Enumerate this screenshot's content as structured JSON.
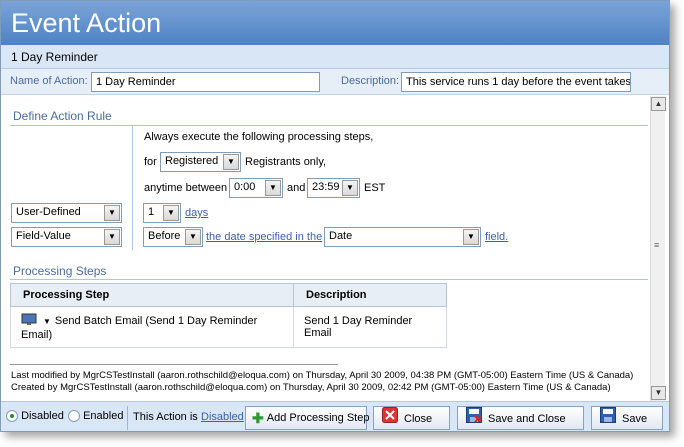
{
  "window": {
    "title": "Event Action",
    "subtitle": "1 Day Reminder"
  },
  "header_fields": {
    "name_label": "Name of Action:",
    "name_value": "1 Day Reminder",
    "description_label": "Description:",
    "description_value": "This service runs 1 day before the event takes"
  },
  "rule": {
    "section_title": "Define Action Rule",
    "always_text": "Always execute the following processing steps,",
    "for_label": "for",
    "registrant_type": "Registered",
    "registrants_only": "Registrants only,",
    "anytime_between": "anytime between",
    "time_start": "0:00",
    "and_label": "and",
    "time_end": "23:59",
    "timezone": "EST",
    "left_select_1": "User-Defined",
    "left_select_2": "Field-Value",
    "count_value": "1",
    "days_link": "days",
    "before_value": "Before",
    "date_specified_link": "the date specified in the",
    "field_value": "Date",
    "field_link": "field."
  },
  "processing": {
    "section_title": "Processing Steps",
    "columns": [
      "Processing Step",
      "Description"
    ],
    "rows": [
      {
        "step": "Send Batch Email (Send 1 Day Reminder Email)",
        "description": "Send 1 Day Reminder Email"
      }
    ]
  },
  "audit": {
    "modified": "Last modified by MgrCSTestInstall (aaron.rothschild@eloqua.com) on Thursday, April 30 2009, 04:38 PM (GMT-05:00) Eastern Time (US & Canada)",
    "created": "Created by MgrCSTestInstall (aaron.rothschild@eloqua.com) on Thursday, April 30 2009, 02:42 PM (GMT-05:00) Eastern Time (US & Canada)"
  },
  "footer": {
    "disabled_label": "Disabled",
    "enabled_label": "Enabled",
    "status_prefix": "This Action is",
    "status_link": "Disabled",
    "add_step_button": "Add Processing Step",
    "close_button": "Close",
    "save_close_button": "Save and Close",
    "save_button": "Save"
  },
  "colors": {
    "title_bar": "#5a8ccb",
    "section_text": "#4a6c9b",
    "link": "#3d5fa8",
    "footer_bg": "#d9e6f5"
  }
}
